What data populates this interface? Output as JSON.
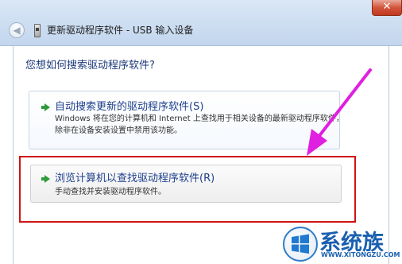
{
  "window": {
    "title": "更新驱动程序软件 - USB 输入设备",
    "close_glyph": "✕",
    "back_glyph": "◀"
  },
  "question": "您想如何搜索驱动程序软件?",
  "options": [
    {
      "title": "自动搜索更新的驱动程序软件(S)",
      "description": "Windows 将在您的计算机和 Internet 上查找用于相关设备的最新驱动程序软件，除非在设备安装设置中禁用该功能。",
      "icon": "green-arrow-icon"
    },
    {
      "title": "浏览计算机以查找驱动程序软件(R)",
      "description": "手动查找并安装驱动程序软件。",
      "icon": "green-arrow-icon"
    }
  ],
  "annotation": {
    "highlight_color": "#d01414",
    "pointer_color": "#e020e0"
  },
  "watermark": {
    "name": "系统族",
    "url": "WWW.XITONGZU.COM",
    "brand_color": "#1a5fb0"
  }
}
